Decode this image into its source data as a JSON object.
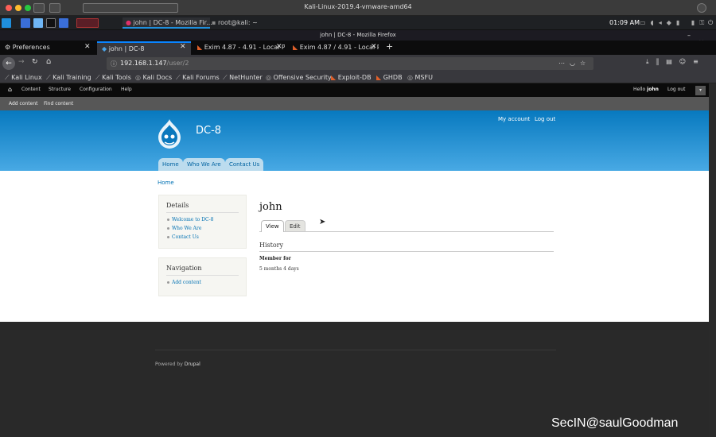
{
  "host_window": {
    "title": "Kali-Linux-2019.4-vmware-amd64"
  },
  "kali_panel": {
    "tasks": [
      "john | DC-8 - Mozilla Fir...",
      "root@kali: ~"
    ],
    "clock": "01:09 AM"
  },
  "firefox": {
    "window_title": "john | DC-8 - Mozilla Firefox",
    "tabs": [
      {
        "label": "Preferences",
        "selected": false
      },
      {
        "label": "john | DC-8",
        "selected": true
      },
      {
        "label": "Exim 4.87 - 4.91 - Local P",
        "selected": false
      },
      {
        "label": "Exim 4.87 / 4.91 - Local P",
        "selected": false
      }
    ],
    "url_host": "192.168.1.147",
    "url_path": "/user/2",
    "bookmarks": [
      "Kali Linux",
      "Kali Training",
      "Kali Tools",
      "Kali Docs",
      "Kali Forums",
      "NetHunter",
      "Offensive Security",
      "Exploit-DB",
      "GHDB",
      "MSFU"
    ]
  },
  "drupal_toolbar": {
    "items": [
      "Content",
      "Structure",
      "Configuration",
      "Help"
    ],
    "hello": "Hello",
    "username": "john",
    "logout": "Log out",
    "shortcuts": [
      "Add content",
      "Find content"
    ]
  },
  "site": {
    "name": "DC-8",
    "secondary_links": [
      "My account",
      "Log out"
    ],
    "main_menu": [
      "Home",
      "Who We Are",
      "Contact Us"
    ],
    "breadcrumb": "Home"
  },
  "sidebar": {
    "details_title": "Details",
    "details_links": [
      "Welcome to DC-8",
      "Who We Are",
      "Contact Us"
    ],
    "nav_title": "Navigation",
    "nav_links": [
      "Add content"
    ]
  },
  "profile": {
    "name": "john",
    "tabs": [
      "View",
      "Edit"
    ],
    "section": "History",
    "member_label": "Member for",
    "member_value": "5 months 4 days"
  },
  "footer": {
    "powered_prefix": "Powered by",
    "powered_link": "Drupal"
  },
  "watermark": "SecIN@saulGoodman"
}
